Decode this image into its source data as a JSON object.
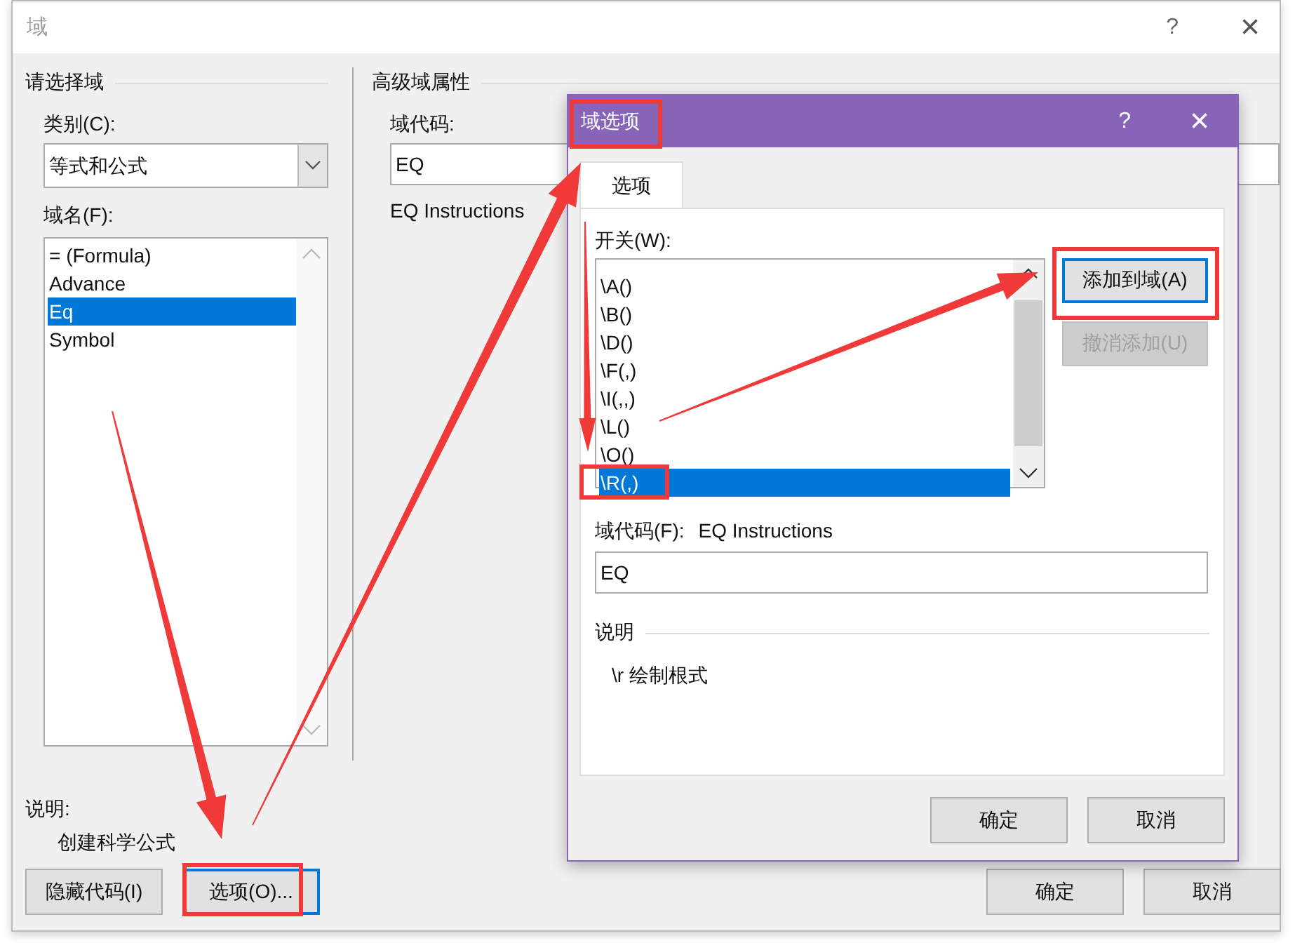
{
  "main_dialog": {
    "title": "域",
    "help": "?",
    "close": "×",
    "left_panel": {
      "heading": "请选择域",
      "category_label": "类别(C):",
      "category_value": "等式和公式",
      "names_label": "域名(F):",
      "names": [
        {
          "label": "= (Formula)",
          "selected": false
        },
        {
          "label": "Advance",
          "selected": false
        },
        {
          "label": "Eq",
          "selected": true
        },
        {
          "label": "Symbol",
          "selected": false
        }
      ]
    },
    "right_panel": {
      "heading": "高级域属性",
      "code_label": "域代码:",
      "code_value": "EQ",
      "instructions": "EQ Instructions"
    },
    "description": {
      "label": "说明:",
      "text": "创建科学公式"
    },
    "left_buttons": [
      {
        "label": "隐藏代码(I)",
        "default": false
      },
      {
        "label": "选项(O)...",
        "default": true
      }
    ],
    "right_buttons": [
      {
        "label": "确定",
        "default": false
      },
      {
        "label": "取消",
        "default": false
      }
    ]
  },
  "options_dialog": {
    "title": "域选项",
    "help": "?",
    "close": "×",
    "tabs": [
      {
        "label": "选项",
        "selected": true
      }
    ],
    "switches_label": "开关(W):",
    "switches": [
      {
        "label": "\\A()",
        "selected": false
      },
      {
        "label": "\\B()",
        "selected": false
      },
      {
        "label": "\\D()",
        "selected": false
      },
      {
        "label": "\\F(,)",
        "selected": false
      },
      {
        "label": "\\I(,,)",
        "selected": false
      },
      {
        "label": "\\L()",
        "selected": false
      },
      {
        "label": "\\O()",
        "selected": false
      },
      {
        "label": "\\R(,)",
        "selected": true
      }
    ],
    "action_buttons": [
      {
        "label": "添加到域(A)",
        "default": true,
        "disabled": false
      },
      {
        "label": "撤消添加(U)",
        "default": false,
        "disabled": true
      }
    ],
    "code_label": "域代码(F):",
    "code_caption": "EQ Instructions",
    "code_value": "EQ",
    "description_heading": "说明",
    "description_text": "\\r 绘制根式",
    "buttons": [
      {
        "label": "确定",
        "default": false
      },
      {
        "label": "取消",
        "default": false
      }
    ]
  }
}
